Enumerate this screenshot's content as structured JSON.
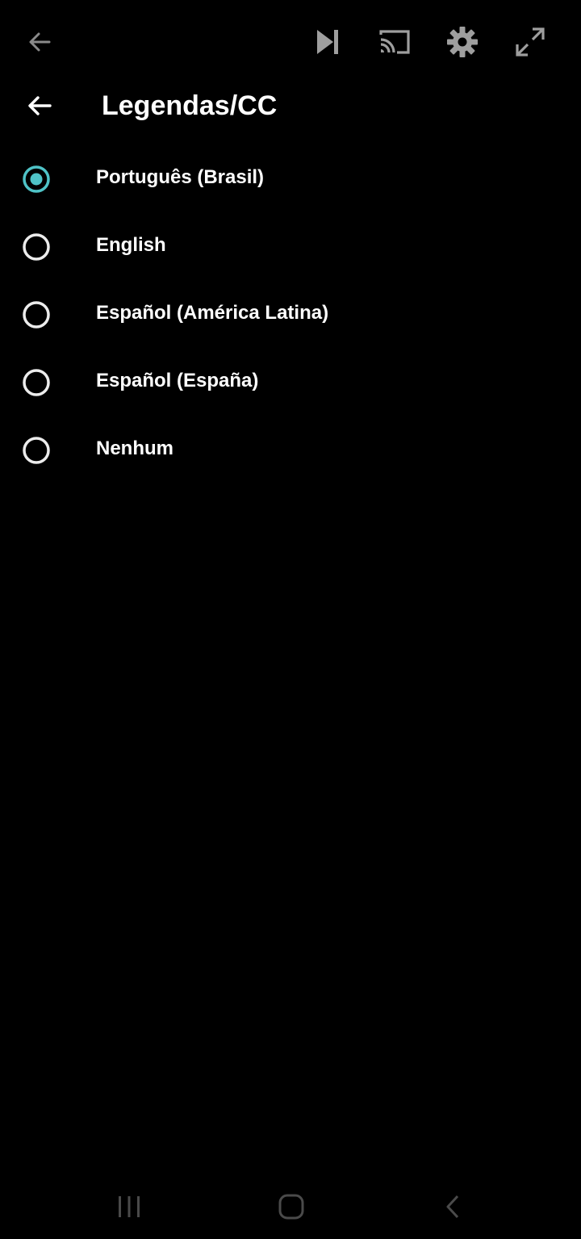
{
  "player_controls": {
    "back_icon": "arrow-left-icon",
    "skip_next_icon": "skip-next-icon",
    "cast_icon": "cast-icon",
    "settings_icon": "gear-icon",
    "fullscreen_icon": "expand-icon",
    "icon_color": "#9e9e9e"
  },
  "subtitles_panel": {
    "back_icon": "arrow-left-icon",
    "title": "Legendas/CC",
    "selected_index": 0,
    "accent_color": "#4fc3c7",
    "options": [
      {
        "label": "Português (Brasil)",
        "selected": true
      },
      {
        "label": "English",
        "selected": false
      },
      {
        "label": "Español (América Latina)",
        "selected": false
      },
      {
        "label": "Español (España)",
        "selected": false
      },
      {
        "label": "Nenhum",
        "selected": false
      }
    ]
  },
  "system_nav": {
    "recents_icon": "recents-icon",
    "home_icon": "home-icon",
    "back_icon": "chevron-left-icon"
  }
}
